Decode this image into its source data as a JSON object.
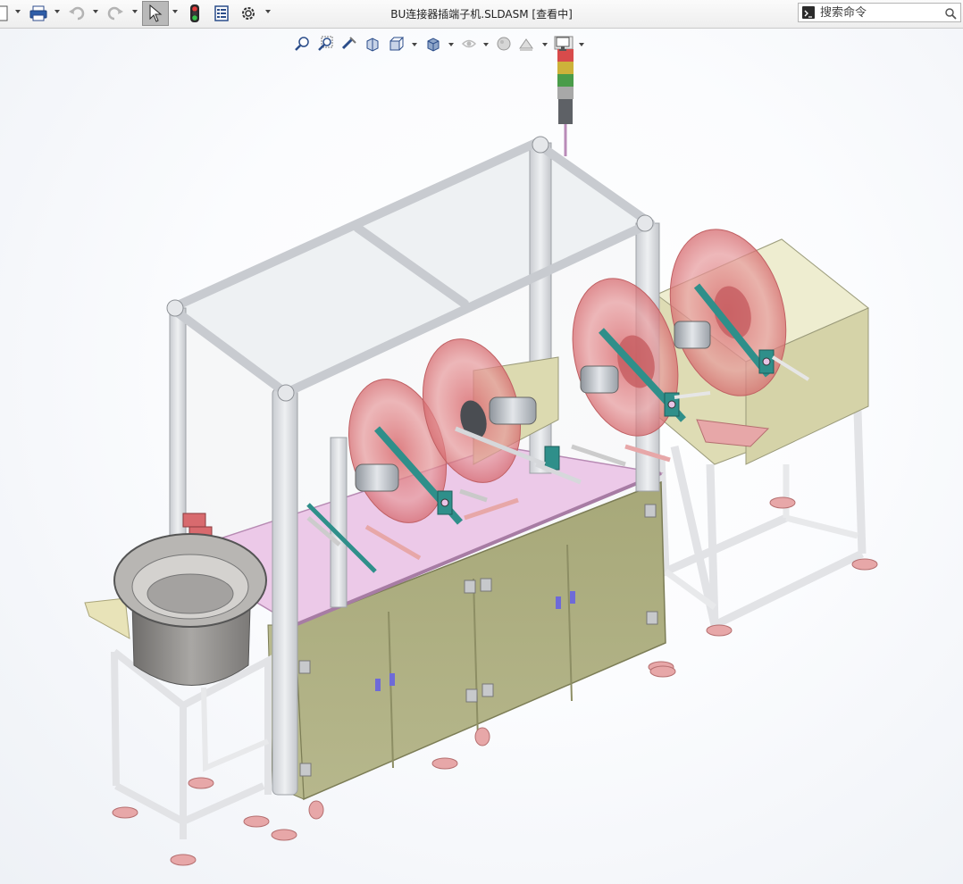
{
  "app": {
    "title": "BU连接器插端子机.SLDASM [查看中]"
  },
  "search": {
    "placeholder": "搜索命令",
    "value": ""
  },
  "toolbar": {
    "items": [
      "new-doc",
      "print",
      "undo",
      "redo",
      "select",
      "rebuild",
      "file-properties",
      "options"
    ]
  },
  "view_toolbar": {
    "items": [
      "zoom-to-fit",
      "zoom-to-area",
      "previous-view",
      "section-view",
      "view-orientation",
      "display-style",
      "hide-show-items",
      "edit-appearance",
      "apply-scene",
      "view-settings"
    ]
  },
  "colors": {
    "frame": "#d9dbdf",
    "cabinet": "#a9aa7c",
    "reel": "#e07e80",
    "motor": "#c8cdd3",
    "bracket": "#2f8f8a",
    "plate": "#e9c4e6",
    "bowl": "#8c8a88",
    "foot": "#e7a7a8"
  }
}
